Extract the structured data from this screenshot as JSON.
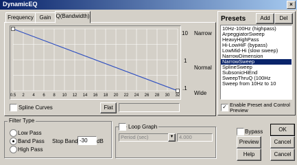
{
  "window": {
    "title": "DynamicEQ",
    "close_label": "×"
  },
  "tabs": [
    {
      "label": "Frequency"
    },
    {
      "label": "Gain"
    },
    {
      "label": "Q(Bandwidth)"
    }
  ],
  "graph": {
    "x_ticks": [
      "0.5",
      "2",
      "4",
      "6",
      "8",
      "10",
      "12",
      "14",
      "16",
      "18",
      "20",
      "22",
      "24",
      "26",
      "28",
      "30",
      "32"
    ],
    "y_ticks": [
      "10",
      "1",
      ".1"
    ],
    "right_labels": [
      "Narrow",
      "Normal",
      "Wide"
    ],
    "envelope_points": [
      [
        0.5,
        10
      ],
      [
        32,
        0.1
      ]
    ]
  },
  "spline_curves": {
    "label": "Spline Curves",
    "checked": false
  },
  "flat_button": "Flat",
  "filter_type": {
    "group_label": "Filter Type",
    "options": [
      {
        "label": "Low Pass",
        "selected": false
      },
      {
        "label": "Band Pass",
        "selected": true
      },
      {
        "label": "High Pass",
        "selected": false
      }
    ],
    "stop_band_label": "Stop Band",
    "stop_band_value": "-30",
    "unit": "dB"
  },
  "loop_graph": {
    "label": "Loop Graph",
    "checked": false,
    "period_value": "Period (sec)",
    "period_number": "4.000"
  },
  "presets": {
    "title": "Presets",
    "add_label": "Add",
    "delete_label": "Del",
    "items": [
      {
        "label": "10Hz-100Hz (highpass)",
        "selected": false
      },
      {
        "label": "ArpeggiatorSweep",
        "selected": false
      },
      {
        "label": "HeavyHighPass",
        "selected": false
      },
      {
        "label": "Hi-LowHiF (bypass)",
        "selected": false
      },
      {
        "label": "LowMid-Hi (slow sweep)",
        "selected": false
      },
      {
        "label": "NarrowDimension",
        "selected": false
      },
      {
        "label": "NarrowSweep",
        "selected": true
      },
      {
        "label": "SplineSweep",
        "selected": false
      },
      {
        "label": "SubsonicHiEnd",
        "selected": false
      },
      {
        "label": "SweepThruQ (100Hz",
        "selected": false
      },
      {
        "label": "Sweep from 10Hz to 10",
        "selected": false
      }
    ],
    "enable_label": "Enable Preset and Control Preview",
    "enable_checked": true
  },
  "bypass": {
    "label": "Bypass",
    "checked": false
  },
  "buttons": {
    "ok": "OK",
    "preview": "Preview",
    "cancel": "Cancel",
    "help": "Help",
    "cancel2": "Cancel"
  },
  "colors": {
    "title_start": "#0a246a",
    "title_end": "#a6caf0",
    "graph_bg": "#d4d0c8",
    "line": "#3050c0",
    "select": "#0a246a"
  }
}
